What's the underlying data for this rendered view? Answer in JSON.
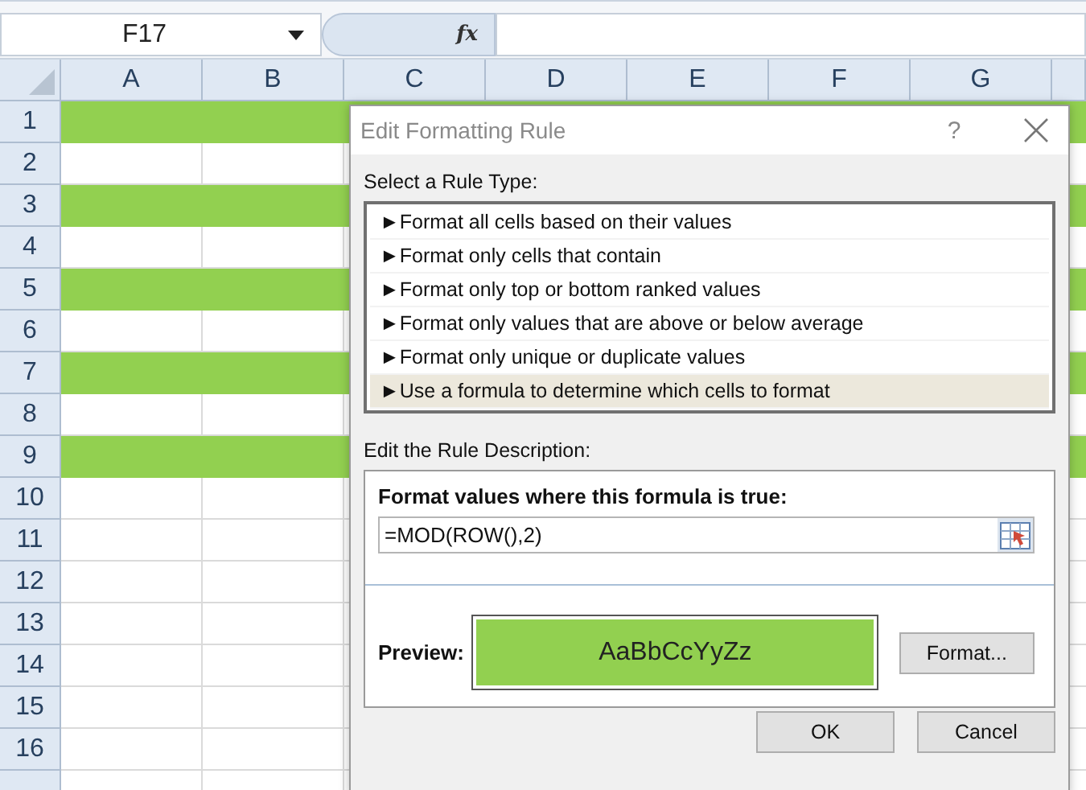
{
  "formula_bar": {
    "name_box": "F17",
    "fx_label": "fx"
  },
  "sheet": {
    "columns": [
      "A",
      "B",
      "C",
      "D",
      "E",
      "F",
      "G"
    ],
    "rows": [
      {
        "label": "1",
        "highlighted": true
      },
      {
        "label": "2",
        "highlighted": false
      },
      {
        "label": "3",
        "highlighted": true
      },
      {
        "label": "4",
        "highlighted": false
      },
      {
        "label": "5",
        "highlighted": true
      },
      {
        "label": "6",
        "highlighted": false
      },
      {
        "label": "7",
        "highlighted": true
      },
      {
        "label": "8",
        "highlighted": false
      },
      {
        "label": "9",
        "highlighted": true
      },
      {
        "label": "10",
        "highlighted": false
      },
      {
        "label": "11",
        "highlighted": false
      },
      {
        "label": "12",
        "highlighted": false
      },
      {
        "label": "13",
        "highlighted": false
      },
      {
        "label": "14",
        "highlighted": false
      },
      {
        "label": "15",
        "highlighted": false
      },
      {
        "label": "16",
        "highlighted": false
      }
    ]
  },
  "dialog": {
    "title": "Edit Formatting Rule",
    "help": "?",
    "rule_type_label": "Select a Rule Type:",
    "rule_types": [
      {
        "label": "Format all cells based on their values",
        "selected": false
      },
      {
        "label": "Format only cells that contain",
        "selected": false
      },
      {
        "label": "Format only top or bottom ranked values",
        "selected": false
      },
      {
        "label": "Format only values that are above or below average",
        "selected": false
      },
      {
        "label": "Format only unique or duplicate values",
        "selected": false
      },
      {
        "label": "Use a formula to determine which cells to format",
        "selected": true
      }
    ],
    "rule_type_marker": "►",
    "description_label": "Edit the Rule Description:",
    "formula_label": "Format values where this formula is true:",
    "formula": "=MOD(ROW(),2)",
    "preview_label": "Preview:",
    "preview_sample": "AaBbCcYyZz",
    "format_button": "Format...",
    "buttons": [
      "OK",
      "Cancel"
    ]
  }
}
